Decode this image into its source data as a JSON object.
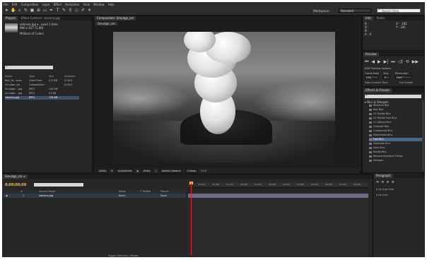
{
  "menu": [
    "File",
    "Edit",
    "Composition",
    "Layer",
    "Effect",
    "Animation",
    "View",
    "Window",
    "Help"
  ],
  "toolbar": {
    "workspace_label": "Workspace:",
    "workspace_value": "Standard",
    "search_help": "Search Help"
  },
  "project": {
    "tabs": [
      "Project",
      "Effect Controls: volcano.jpg"
    ],
    "filename": "volcano.jpg ▾ , used 1 time",
    "dimensions": "990 x 627 (1.00)",
    "colors": "Millions of Colors",
    "columns": [
      "Name",
      "Type",
      "Size",
      "Duration"
    ],
    "rows": [
      {
        "name": "Red_Ye...aves",
        "type": "QuickTime",
        "size": "3.2 MB",
        "dur": "0;00;0"
      },
      {
        "name": "Smudge_sm",
        "type": "Composition",
        "size": "",
        "dur": "0;00;2"
      },
      {
        "name": "Smudge....jpg",
        "type": "JPEG",
        "size": "140 KB",
        "dur": ""
      },
      {
        "name": "Smudge....jpg",
        "type": "JPEG",
        "size": "53 KB",
        "dur": ""
      },
      {
        "name": "volcano.jpg",
        "type": "JPEG",
        "size": "132 KB",
        "dur": ""
      }
    ],
    "bpc": "8 bpc"
  },
  "viewer": {
    "tabs": [
      "Composition: Smudge_sm"
    ],
    "subtab": "Smudge_sm",
    "zoom": "100%",
    "time": "0;00;00;00",
    "resolution": "(Full)",
    "camera": "Active Camera",
    "views": "1 View",
    "offset": "+0.0"
  },
  "info": {
    "tabs": [
      "Info",
      "Audio"
    ],
    "rgb": [
      "R :",
      "G :",
      "B :",
      "A : 0"
    ],
    "xy": [
      "X : -182",
      "Y : 341"
    ]
  },
  "preview": {
    "tab": "Preview",
    "ram_options": "RAM Preview Options",
    "frame_rate_label": "Frame Rate",
    "skip_label": "Skip",
    "resolution_label": "Resolution",
    "frame_rate": "(30)",
    "skip": "0",
    "resolution": "Half",
    "from_current": "From Current Time",
    "full_screen": "Full Screen"
  },
  "effects": {
    "tab": "Effects & Presets",
    "category": "▾ Blur & Sharpen",
    "items": [
      "Bilateral Blur",
      "Box Blur",
      "CC Radial Blur",
      "CC Radial Fast Blur",
      "CC Vector Blur",
      "Channel Blur",
      "Compound Blur",
      "Directional Blur",
      "Fast Blur",
      "Gaussian Blur",
      "Lens Blur",
      "Radial Blur",
      "Reduce Interlace Flicker",
      "Sharpen"
    ],
    "selected_index": 8
  },
  "timeline": {
    "tab": "Smudge_sm ≡",
    "timecode": "0;00;00;00",
    "ruler": [
      "00:15f",
      "01:00f",
      "01:15f",
      "02:00f",
      "02:15f",
      "03:00f",
      "03:15f",
      "04:00f",
      "04:15f",
      "05:00f",
      "05:15f",
      "06:00f"
    ],
    "layer_columns": [
      "#",
      "Source Name",
      "Mode",
      "T TrkMat",
      "Parent"
    ],
    "layer": {
      "num": "1",
      "name": "volcano.jpg",
      "mode": "Norm",
      "trkmat": "",
      "parent": "None"
    },
    "toggle": "Toggle Switches / Modes"
  },
  "paragraph": {
    "tab": "Paragraph",
    "rows": [
      "0 px  0 px  0 px",
      "0 px  0 px"
    ]
  }
}
